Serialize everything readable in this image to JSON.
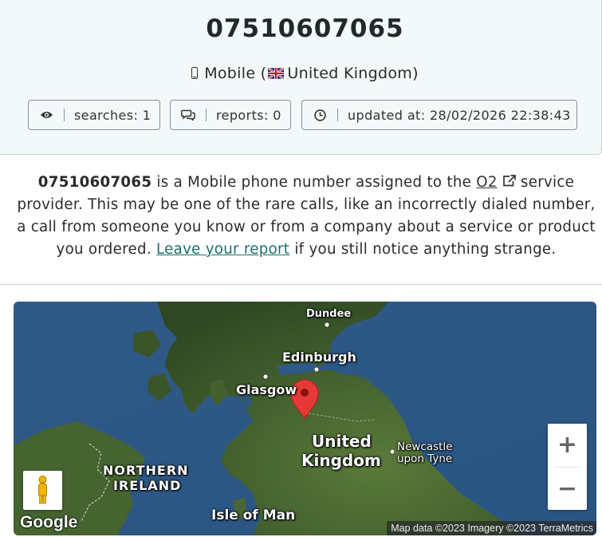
{
  "header": {
    "phone_number": "07510607065",
    "line_type": "Mobile",
    "country": "United Kingdom",
    "stats": {
      "searches_label": "searches: 1",
      "reports_label": "reports: 0",
      "updated_label": "updated at: 28/02/2026 22:38:43"
    }
  },
  "description": {
    "number": "07510607065",
    "part1": " is a Mobile phone number assigned to the ",
    "carrier": "O2",
    "part2": " service provider. This may be one of the rare calls, like an incorrectly dialed number, a call from someone you know or from a company about a service or product you ordered. ",
    "report_link": "Leave your report",
    "part3": " if you still notice anything strange."
  },
  "map": {
    "labels": {
      "dundee": "Dundee",
      "edinburgh": "Edinburgh",
      "glasgow": "Glasgow",
      "uk_line1": "United",
      "uk_line2": "Kingdom",
      "newcastle_line1": "Newcastle",
      "newcastle_line2": "upon Tyne",
      "ni_line1": "NORTHERN",
      "ni_line2": "IRELAND",
      "isle_of_man": "Isle of Man"
    },
    "zoom_in": "+",
    "zoom_out": "−",
    "google_logo": "Google",
    "attribution": "Map data ©2023 Imagery ©2023 TerraMetrics",
    "colors": {
      "sea": "#2f5a87",
      "land": "#3d5a2a",
      "marker": "#e53935"
    }
  }
}
